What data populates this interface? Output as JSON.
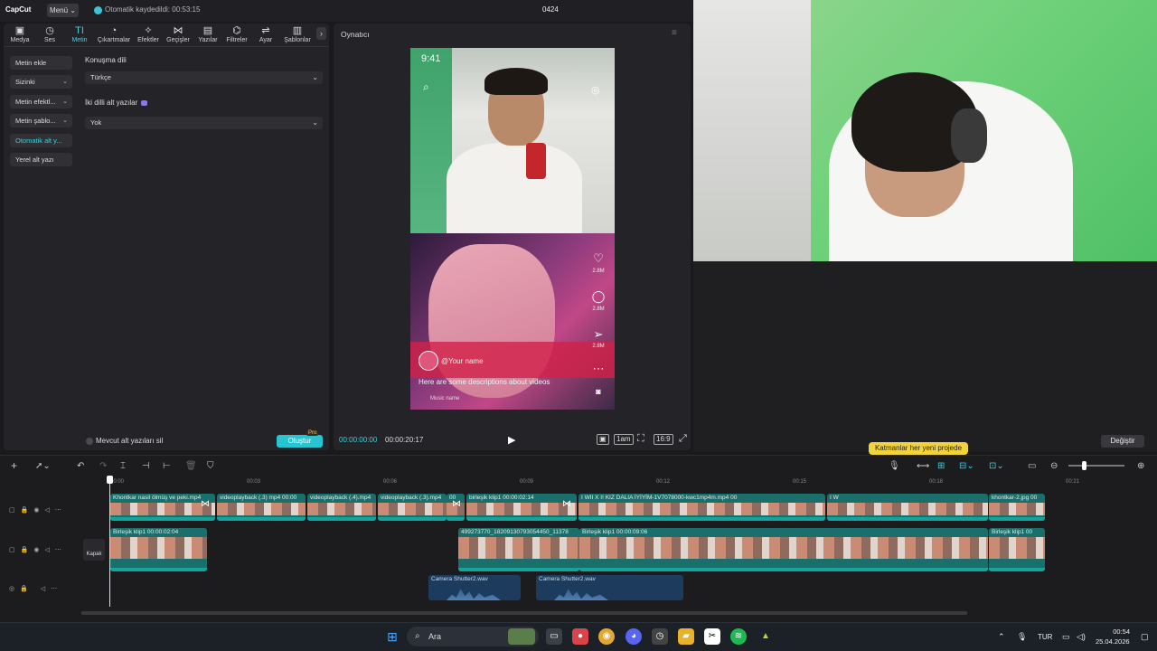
{
  "app": {
    "logo": "CapCut",
    "menu_label": "Menü ⌄",
    "autosave": "Otomatik kaydedildi: 00:53:15",
    "project_title": "0424"
  },
  "tabs": [
    {
      "label": "Medya",
      "icon": "▣"
    },
    {
      "label": "Ses",
      "icon": "◷"
    },
    {
      "label": "Metin",
      "icon": "TI"
    },
    {
      "label": "Çıkartmalar",
      "icon": "◔"
    },
    {
      "label": "Efektler",
      "icon": "✧"
    },
    {
      "label": "Geçişler",
      "icon": "⋈"
    },
    {
      "label": "Yazılar",
      "icon": "▤"
    },
    {
      "label": "Filtreler",
      "icon": "⌬"
    },
    {
      "label": "Ayar",
      "icon": "⇌"
    },
    {
      "label": "Şablonlar",
      "icon": "▥"
    }
  ],
  "sidebar": [
    {
      "label": "Metin ekle"
    },
    {
      "label": "Sizinki"
    },
    {
      "label": "Metin efektl..."
    },
    {
      "label": "Metin şablo..."
    },
    {
      "label": "Otomatik alt y..."
    },
    {
      "label": "Yerel alt yazı"
    }
  ],
  "captions": {
    "speech_lang_label": "Konuşma dili",
    "speech_lang_value": "Türkçe",
    "bilingual_label": "İki dilli alt yazılar",
    "bilingual_value": "Yok",
    "clear_existing_label": "Mevcut alt yazıları sil",
    "create_label": "Oluştur",
    "pro_badge": "Pro"
  },
  "player": {
    "title": "Oynatıcı",
    "time_current": "00:00:00:00",
    "time_total": "00:00:20:17",
    "preview_time": "9:41",
    "username": "@Your name",
    "description": "Here are some descriptions about videos",
    "music": "Music name",
    "like_count": "2.8M",
    "comment_count": "2.8M",
    "share_count": "2.8M",
    "ratio_label": "16:9",
    "fit_label": "1am"
  },
  "right_panel": {
    "replace_label": "Değiştir",
    "tooltip": "Katmanlar her yeni projede"
  },
  "timeline": {
    "ruler": [
      "00:00",
      "00:03",
      "00:06",
      "00:09",
      "00:12",
      "00:15",
      "00:18",
      "00:21"
    ],
    "cover_label": "Kapak",
    "main_clips": [
      "Khontkar nasil ölmüş ve peki.mp4",
      "videoplayback (.3) mp4  00:00",
      "videoplayback (.4).mp4",
      "videoplayback (.3).mp4",
      "00",
      "birleşik klip1  00:00:02:14",
      "I WII X I! KIZ  DALIA İYİYİM-1V7078000-kwc1mp4m.mp4  00",
      "I W",
      "khontkar-2.jpg  00"
    ],
    "overlay_clips": [
      "Birleşik klip1  00:00:02:04",
      "499273770_18209130793054450_11378",
      "Birleşik klip1  00:00:09:06",
      "Birleşik klip1  00"
    ],
    "audio_clips": [
      "Camera Shutter2.wav",
      "Camera Shutter2.wav"
    ]
  },
  "taskbar": {
    "search_label": "Ara",
    "lang": "TUR",
    "time": "00:54",
    "date": "25.04.2026"
  }
}
